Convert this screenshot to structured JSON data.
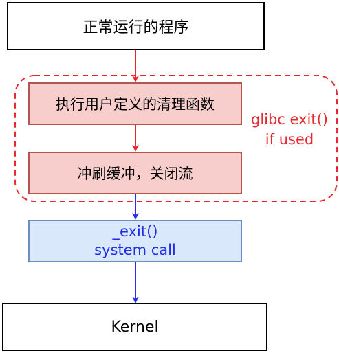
{
  "nodes": {
    "start": "正常运行的程序",
    "cleanup": "执行用户定义的清理函数",
    "flush": "冲刷缓冲，关闭流",
    "exit_call_line1": "_exit()",
    "exit_call_line2": "system call",
    "kernel": "Kernel"
  },
  "group": {
    "label_line1": "glibc exit()",
    "label_line2": "if used"
  },
  "colors": {
    "red_accent": "#e8282e",
    "blue_accent": "#1f2ee6",
    "red_fill": "#f8cecc",
    "blue_fill": "#dae8fc"
  }
}
